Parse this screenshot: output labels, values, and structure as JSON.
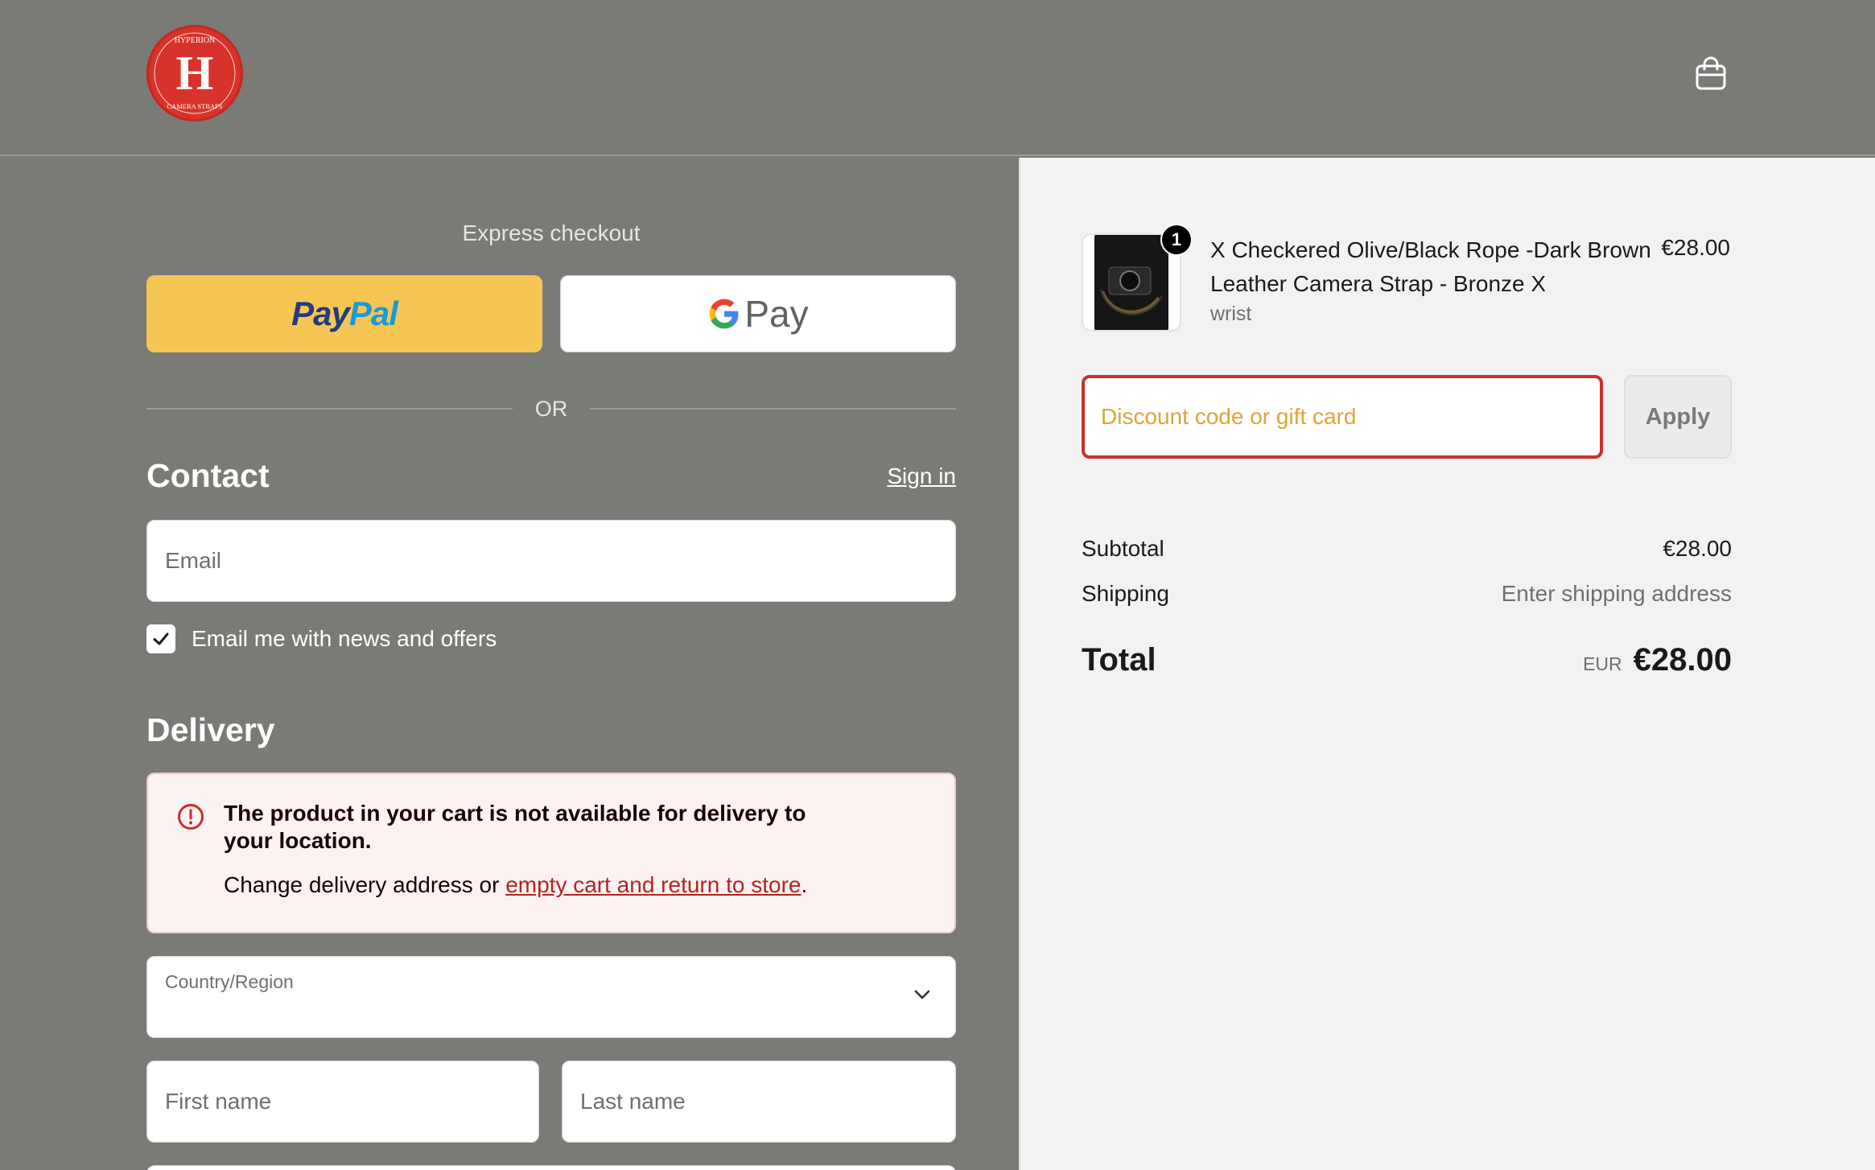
{
  "header": {
    "logo": {
      "top_text": "HYPERION",
      "monogram": "H",
      "bottom_text": "CAMERA STRAPS",
      "color": "#d8332a"
    },
    "cart_icon": "shopping-bag-icon"
  },
  "express_checkout": {
    "title": "Express checkout",
    "paypal": {
      "pay": "Pay",
      "pal": "Pal"
    },
    "gpay": {
      "g": "G",
      "pay": "Pay"
    },
    "divider": "OR"
  },
  "contact": {
    "title": "Contact",
    "signin_label": "Sign in",
    "email_placeholder": "Email",
    "newsletter_label": "Email me with news and offers",
    "newsletter_checked": true
  },
  "delivery": {
    "title": "Delivery",
    "alert": {
      "icon": "alert-circle-icon",
      "title": "The product in your cart is not available for delivery to your location.",
      "body_prefix": "Change delivery address or ",
      "link_text": "empty cart and return to store",
      "body_suffix": "."
    },
    "country_label": "Country/Region",
    "first_name_placeholder": "First name",
    "last_name_placeholder": "Last name"
  },
  "order_summary": {
    "item": {
      "name": "X Checkered Olive/Black Rope -Dark Brown Leather Camera Strap - Bronze X",
      "variant": "wrist",
      "price": "€28.00",
      "quantity": "1"
    },
    "discount_placeholder": "Discount code or gift card",
    "apply_label": "Apply",
    "subtotal_label": "Subtotal",
    "subtotal_value": "€28.00",
    "shipping_label": "Shipping",
    "shipping_value": "Enter shipping address",
    "total_label": "Total",
    "currency": "EUR",
    "total_value": "€28.00"
  },
  "colors": {
    "overlay": "#7a7a77",
    "paypal_yellow": "#f6c655",
    "error_red": "#c9302c",
    "alert_bg": "#fcf2f2"
  }
}
